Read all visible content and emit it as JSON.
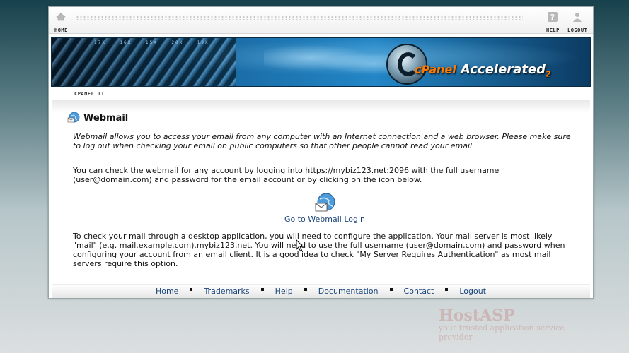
{
  "topbar": {
    "home_label": "HOME",
    "help_label": "HELP",
    "logout_label": "LOGOUT"
  },
  "banner": {
    "numbers": "17X 16X 15X 20X 19X",
    "brand_cpanel": "cPanel",
    "brand_accelerated": "Accelerated",
    "brand_version": "2"
  },
  "breadcrumb": {
    "label": "CPANEL 11"
  },
  "page": {
    "title": "Webmail",
    "intro": "Webmail allows you to access your email from any computer with an Internet connection and a web browser. Please make sure to log out when checking your email on public computers so that other people cannot read your email.",
    "instructions": "You can check the webmail for any account by logging into https://mybiz123.net:2096 with the full username (user@domain.com) and password for the email account or by clicking on the icon below.",
    "login_link": "Go to Webmail Login",
    "desktop_note": "To check your mail through a desktop application, you will need to configure the application. Your mail server is most likely \"mail\" (e.g. mail.example.com).mybiz123.net. You will need to use the full username (user@domain.com) and password when configuring your account from an email client. It is a good idea to check \"My Server Requires Authentication\" as most mail servers require this option."
  },
  "footer": {
    "links": [
      "Home",
      "Trademarks",
      "Help",
      "Documentation",
      "Contact",
      "Logout"
    ]
  },
  "watermark": {
    "brand": "HostASP",
    "tagline": "your trusted application service provider"
  },
  "colors": {
    "link": "#19457a",
    "accent_orange": "#ff7a00"
  }
}
